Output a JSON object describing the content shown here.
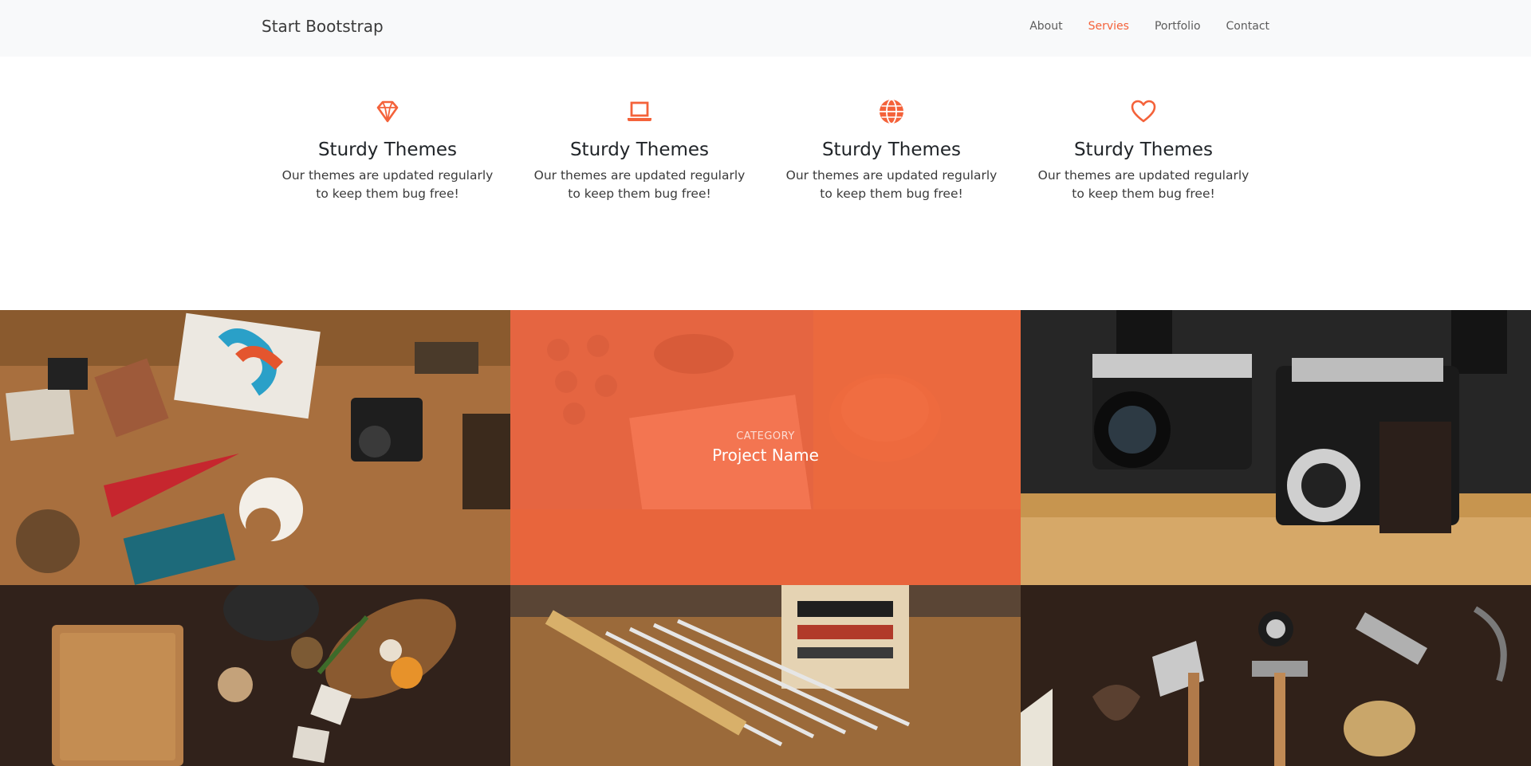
{
  "nav": {
    "brand": "Start Bootstrap",
    "links": [
      {
        "label": "About",
        "active": false
      },
      {
        "label": "Servies",
        "active": true
      },
      {
        "label": "Portfolio",
        "active": false
      },
      {
        "label": "Contact",
        "active": false
      }
    ]
  },
  "services": [
    {
      "icon": "gem-icon",
      "title": "Sturdy Themes",
      "text": "Our themes are updated regularly to keep them bug free!"
    },
    {
      "icon": "laptop-icon",
      "title": "Sturdy Themes",
      "text": "Our themes are updated regularly to keep them bug free!"
    },
    {
      "icon": "globe-icon",
      "title": "Sturdy Themes",
      "text": "Our themes are updated regularly to keep them bug free!"
    },
    {
      "icon": "heart-icon",
      "title": "Sturdy Themes",
      "text": "Our themes are updated regularly to keep them bug free!"
    }
  ],
  "portfolio": {
    "hovered": {
      "category": "CATEGORY",
      "project": "Project Name"
    },
    "tiles": [
      "desk-flatlay-photo",
      "desk-accessories-photo",
      "vintage-cameras-photo",
      "kitchen-spices-photo",
      "paint-brushes-photo",
      "tools-photo"
    ]
  },
  "colors": {
    "accent": "#f4623a",
    "navbar_bg": "#f8f9fa",
    "text": "#212529"
  }
}
